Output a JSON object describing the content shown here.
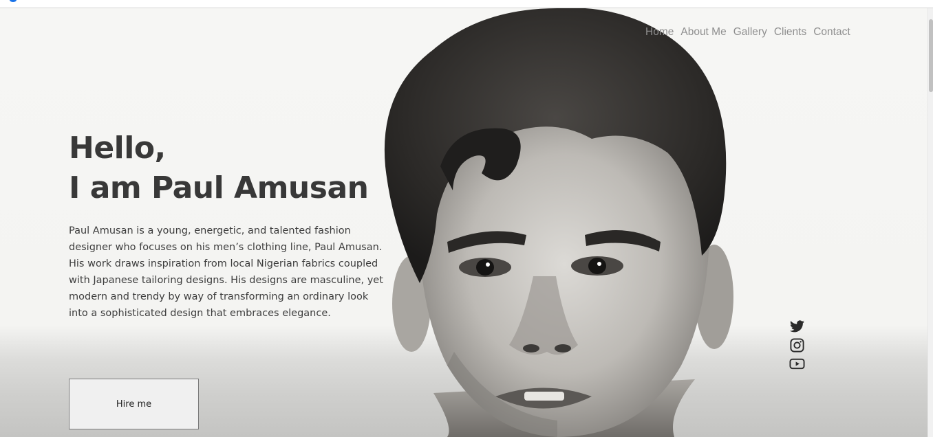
{
  "nav": {
    "items": [
      {
        "label": "Home"
      },
      {
        "label": "About Me"
      },
      {
        "label": "Gallery"
      },
      {
        "label": "Clients"
      },
      {
        "label": "Contact"
      }
    ]
  },
  "hero": {
    "greeting": "Hello,",
    "title": "I am Paul Amusan",
    "bio": "Paul Amusan is a young, energetic, and talented fashion designer who focuses on his men’s clothing line, Paul Amusan. His work draws inspiration from local Nigerian fabrics coupled with Japanese tailoring designs. His designs are masculine, yet modern and trendy by way of transforming an ordinary look into a sophisticated design that embraces elegance.",
    "cta_label": "Hire me"
  },
  "social": {
    "icons": [
      "twitter-icon",
      "instagram-icon",
      "youtube-icon"
    ]
  },
  "theme": {
    "text_color": "#383838",
    "nav_color": "#8f8f8f",
    "background": "#f5f5f3"
  }
}
